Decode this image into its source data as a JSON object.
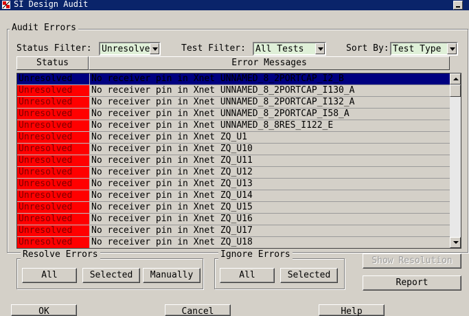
{
  "window": {
    "title": "SI Design Audit"
  },
  "audit_errors": {
    "group_label": "Audit Errors",
    "status_filter": {
      "label": "Status Filter:",
      "value": "Unresolve"
    },
    "test_filter": {
      "label": "Test Filter:",
      "value": "All Tests"
    },
    "sort_by": {
      "label": "Sort By:",
      "value": "Test Type"
    },
    "columns": {
      "status": "Status",
      "messages": "Error Messages"
    },
    "rows": [
      {
        "status": "Unresolved",
        "message": "No receiver pin in Xnet UNNAMED_8_2PORTCAP_I2_B",
        "selected": true
      },
      {
        "status": "Unresolved",
        "message": "No receiver pin in Xnet UNNAMED_8_2PORTCAP_I130_A"
      },
      {
        "status": "Unresolved",
        "message": "No receiver pin in Xnet UNNAMED_8_2PORTCAP_I132_A"
      },
      {
        "status": "Unresolved",
        "message": "No receiver pin in Xnet UNNAMED_8_2PORTCAP_I58_A"
      },
      {
        "status": "Unresolved",
        "message": "No receiver pin in Xnet UNNAMED_8_8RES_I122_E"
      },
      {
        "status": "Unresolved",
        "message": "No receiver pin in Xnet ZQ_U1"
      },
      {
        "status": "Unresolved",
        "message": "No receiver pin in Xnet ZQ_U10"
      },
      {
        "status": "Unresolved",
        "message": "No receiver pin in Xnet ZQ_U11"
      },
      {
        "status": "Unresolved",
        "message": "No receiver pin in Xnet ZQ_U12"
      },
      {
        "status": "Unresolved",
        "message": "No receiver pin in Xnet ZQ_U13"
      },
      {
        "status": "Unresolved",
        "message": "No receiver pin in Xnet ZQ_U14"
      },
      {
        "status": "Unresolved",
        "message": "No receiver pin in Xnet ZQ_U15"
      },
      {
        "status": "Unresolved",
        "message": "No receiver pin in Xnet ZQ_U16"
      },
      {
        "status": "Unresolved",
        "message": "No receiver pin in Xnet ZQ_U17"
      },
      {
        "status": "Unresolved",
        "message": "No receiver pin in Xnet ZQ_U18"
      }
    ]
  },
  "resolve_errors": {
    "label": "Resolve Errors",
    "all": "All",
    "selected": "Selected",
    "manually": "Manually"
  },
  "ignore_errors": {
    "label": "Ignore Errors",
    "all": "All",
    "selected": "Selected"
  },
  "side_buttons": {
    "show_resolution": "Show Resolution",
    "report": "Report"
  },
  "footer": {
    "ok": "OK",
    "cancel": "Cancel",
    "help": "Help"
  },
  "colors": {
    "titlebar": "#0a246a",
    "unresolved": "#ff0000",
    "selected_row": "#000080",
    "combo_bg": "#dff0d8"
  }
}
